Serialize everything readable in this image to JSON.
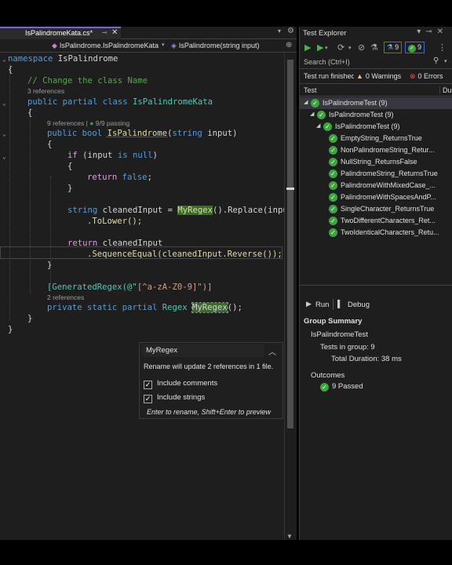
{
  "editor": {
    "tab_title": "IsPalindromeKata.cs*",
    "nav_namespace": "IsPalindrome.IsPalindromeKata",
    "nav_member": "IsPalindrome(string input)"
  },
  "code": {
    "l_namespace_kw": "namespace",
    "l_namespace_name": "IsPalindrome",
    "brace_open": "{",
    "brace_close": "}",
    "comment": "// Change the class Name",
    "lens_class": "3 references",
    "kw_public": "public",
    "kw_partial": "partial",
    "kw_class": "class",
    "class_name": "IsPalindromeKata",
    "lens_method_refs": "9 references",
    "lens_method_sep": "|",
    "lens_method_passing": "9/9 passing",
    "kw_bool": "bool",
    "method_name": "IsPalindrome",
    "kw_string": "string",
    "param": "input",
    "paren_close": ")",
    "kw_if": "if",
    "if_open": "(input",
    "kw_is": "is",
    "kw_null": "null",
    "kw_return": "return",
    "kw_false": "false",
    "semicolon": ";",
    "var_cleaned": "cleanedInput",
    "eq": "=",
    "regex_name": "MyRegex",
    "replace_call": "().Replace(input",
    "tolower": ".ToLower();",
    "ret_cleaned": "cleanedInput",
    "seq_equal": ".SequenceEqual(cleanedInput.Reverse());",
    "attr_open": "[GeneratedRegex(@\"",
    "attr_pattern": "[^a-zA-Z0-9]",
    "attr_close": "\")]",
    "lens_regex": "2 references",
    "kw_private": "private",
    "kw_static": "static",
    "type_regex": "Regex",
    "regex_tail": "();"
  },
  "rename_popup": {
    "value": "MyRegex",
    "info": "Rename will update 2 references in 1 file.",
    "opt_comments": "Include comments",
    "opt_strings": "Include strings",
    "hint": "Enter to rename, Shift+Enter to preview"
  },
  "test_explorer": {
    "title": "Test Explorer",
    "toolbar_total": "9",
    "toolbar_passed": "9",
    "search_placeholder": "Search (Ctrl+I)",
    "status_run": "Test run finished",
    "status_warnings": "0 Warnings",
    "status_errors": "0 Errors",
    "col_test": "Test",
    "col_duration": "Du",
    "tree": [
      {
        "label": "IsPalindromeTest (9)"
      },
      {
        "label": "IsPalindromeTest (9)"
      },
      {
        "label": "IsPalindromeTest (9)"
      },
      {
        "label": "EmptyString_ReturnsTrue"
      },
      {
        "label": "NonPalindromeString_Retur..."
      },
      {
        "label": "NullString_ReturnsFalse"
      },
      {
        "label": "PalindromeString_ReturnsTrue"
      },
      {
        "label": "PalindromeWithMixedCase_..."
      },
      {
        "label": "PalindromeWithSpacesAndP..."
      },
      {
        "label": "SingleCharacter_ReturnsTrue"
      },
      {
        "label": "TwoDifferentCharacters_Ret..."
      },
      {
        "label": "TwoIdenticalCharacters_Retu..."
      }
    ],
    "run_label": "Run",
    "debug_label": "Debug",
    "summary": {
      "header": "Group Summary",
      "group_name": "IsPalindromeTest",
      "tests_in_group": "Tests in group: 9",
      "total_duration": "Total Duration: 38 ms",
      "outcomes": "Outcomes",
      "passed": "9 Passed"
    }
  },
  "colors": {
    "editor_bg": "#1e1e1e",
    "keyword": "#569cd6",
    "type": "#4ec9b0",
    "method": "#dcdcaa",
    "comment": "#57a64a",
    "string": "#d69d85",
    "pass_green": "#3ba53f",
    "tab_accent": "#7a64d6"
  }
}
